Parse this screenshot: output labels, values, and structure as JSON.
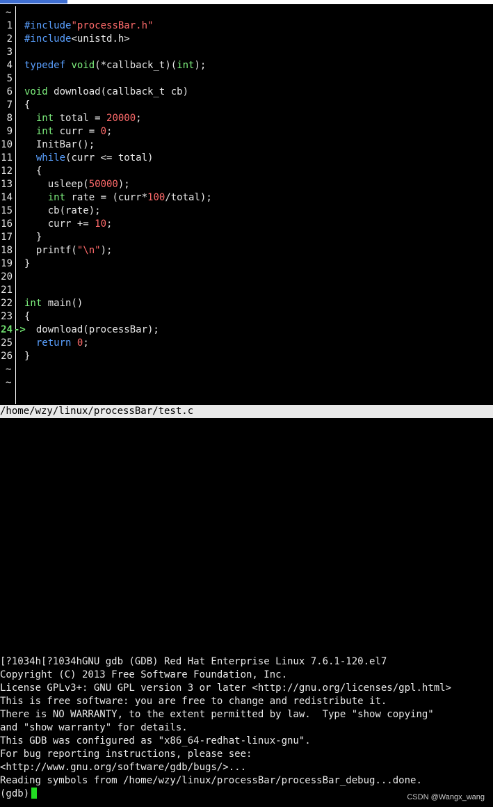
{
  "file_path": "/home/wzy/linux/processBar/test.c",
  "tilde": "~",
  "arrow": "->",
  "current_line": 24,
  "gdb_prompt": "(gdb)",
  "gdb_output": [
    "[?1034h[?1034hGNU gdb (GDB) Red Hat Enterprise Linux 7.6.1-120.el7",
    "Copyright (C) 2013 Free Software Foundation, Inc.",
    "License GPLv3+: GNU GPL version 3 or later <http://gnu.org/licenses/gpl.html>",
    "This is free software: you are free to change and redistribute it.",
    "There is NO WARRANTY, to the extent permitted by law.  Type \"show copying\"",
    "and \"show warranty\" for details.",
    "This GDB was configured as \"x86_64-redhat-linux-gnu\".",
    "For bug reporting instructions, please see:",
    "<http://www.gnu.org/software/gdb/bugs/>...",
    "Reading symbols from /home/wzy/linux/processBar/processBar_debug...done."
  ],
  "watermark": "CSDN @Wangx_wang",
  "colors": {
    "keyword": "#7ef07e",
    "control": "#5aa0ff",
    "literal": "#ff6b6b",
    "cursor": "#22dd22",
    "status_bg": "#e9e9e9"
  },
  "source_lines": [
    {
      "n": "1",
      "html": "<span class='pp'>#include</span><span class='str'>\"processBar.h\"</span>"
    },
    {
      "n": "2",
      "html": "<span class='pp'>#include</span>&lt;unistd.h&gt;"
    },
    {
      "n": "3",
      "html": ""
    },
    {
      "n": "4",
      "html": "<span class='kwb'>typedef</span> <span class='ty'>void</span>(*callback_t)(<span class='ty'>int</span>);"
    },
    {
      "n": "5",
      "html": ""
    },
    {
      "n": "6",
      "html": "<span class='ty'>void</span> download(callback_t cb)"
    },
    {
      "n": "7",
      "html": "{"
    },
    {
      "n": "8",
      "html": "  <span class='ty'>int</span> total = <span class='num'>20000</span>;"
    },
    {
      "n": "9",
      "html": "  <span class='ty'>int</span> curr = <span class='num'>0</span>;"
    },
    {
      "n": "10",
      "html": "  InitBar();"
    },
    {
      "n": "11",
      "html": "  <span class='kwb'>while</span>(curr &lt;= total)"
    },
    {
      "n": "12",
      "html": "  {"
    },
    {
      "n": "13",
      "html": "    usleep(<span class='num'>50000</span>);"
    },
    {
      "n": "14",
      "html": "    <span class='ty'>int</span> rate = (curr*<span class='num'>100</span>/total);"
    },
    {
      "n": "15",
      "html": "    cb(rate);"
    },
    {
      "n": "16",
      "html": "    curr += <span class='num'>10</span>;"
    },
    {
      "n": "17",
      "html": "  }"
    },
    {
      "n": "18",
      "html": "  printf(<span class='str'>\"\\n\"</span>);"
    },
    {
      "n": "19",
      "html": "}"
    },
    {
      "n": "20",
      "html": ""
    },
    {
      "n": "21",
      "html": ""
    },
    {
      "n": "22",
      "html": "<span class='ty'>int</span> main()"
    },
    {
      "n": "23",
      "html": "{"
    },
    {
      "n": "24",
      "html": "  download(processBar);"
    },
    {
      "n": "25",
      "html": "  <span class='kwb'>return</span> <span class='num'>0</span>;"
    },
    {
      "n": "26",
      "html": "}"
    }
  ]
}
